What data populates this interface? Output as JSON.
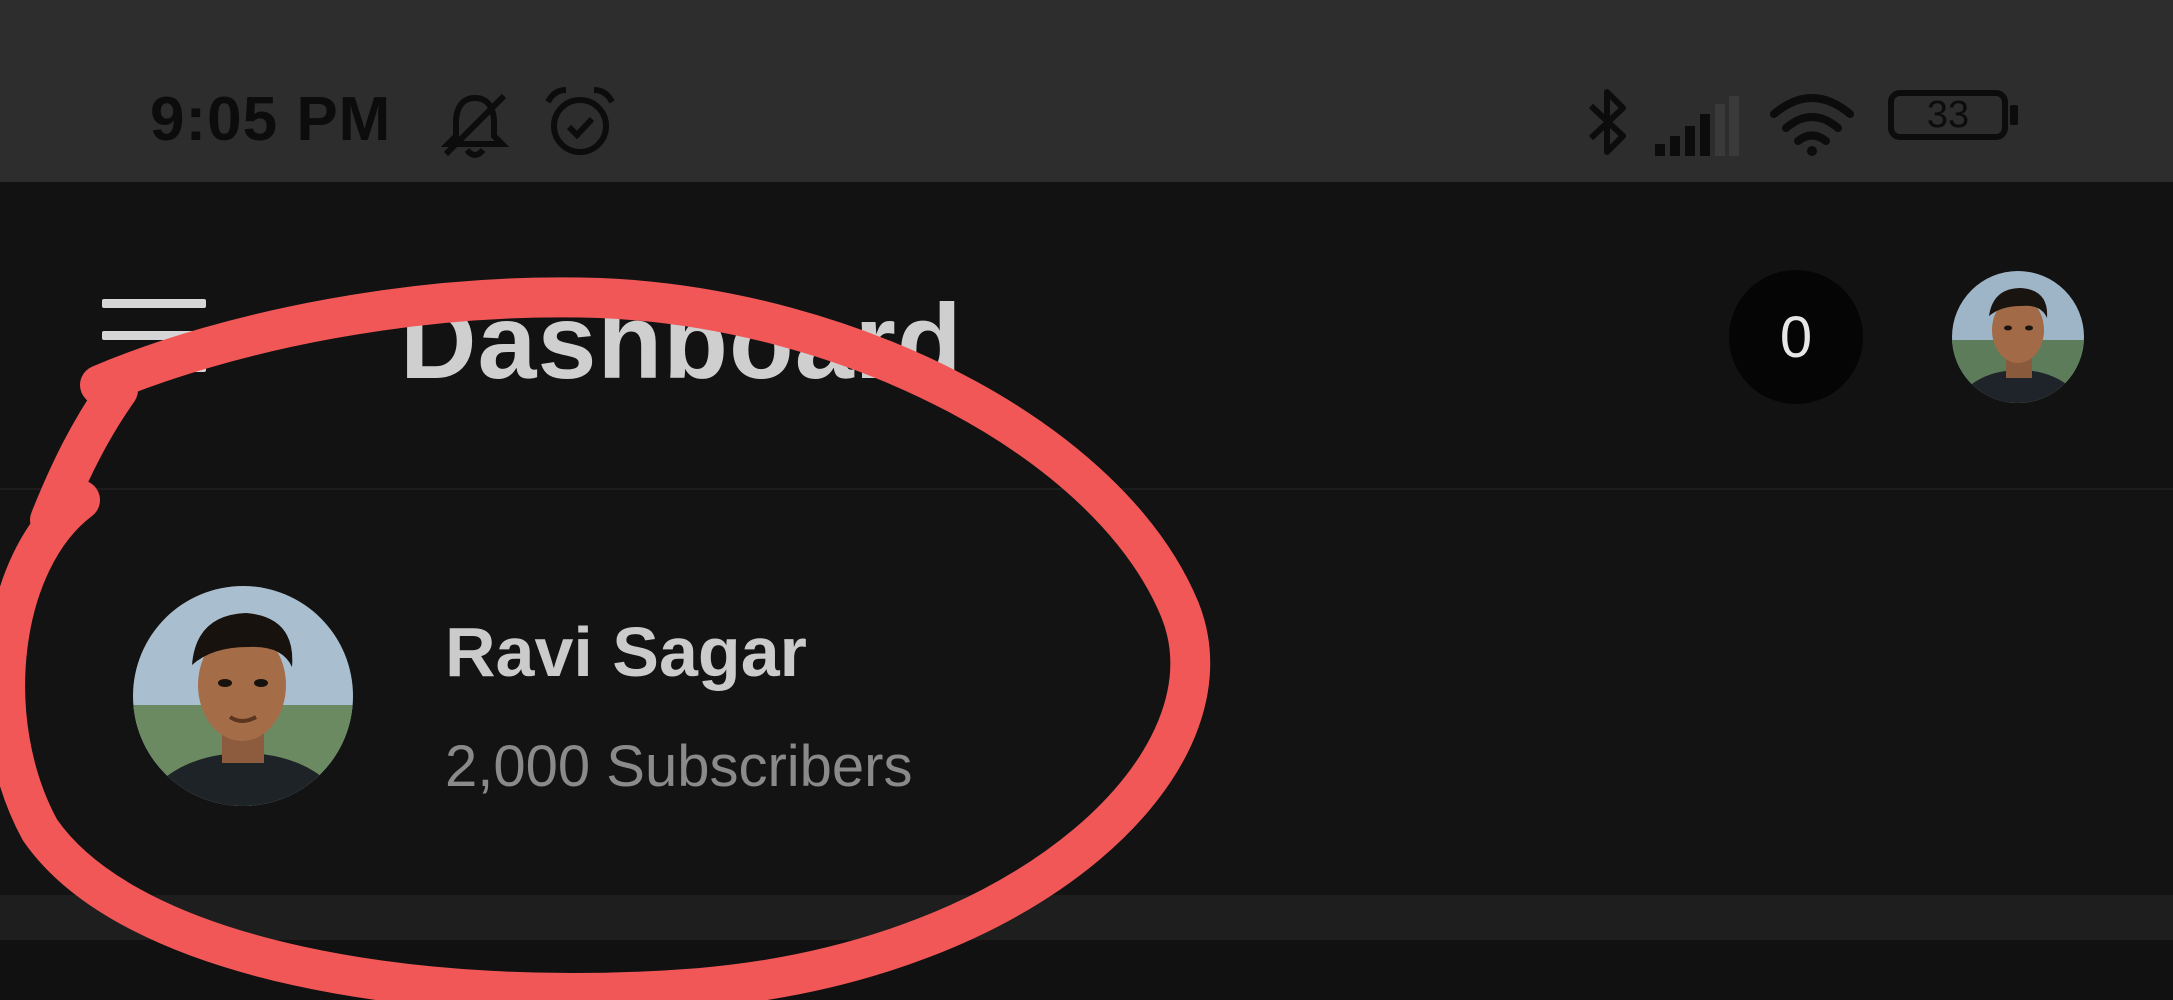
{
  "status_bar": {
    "time": "9:05 PM",
    "icons": [
      "dnd-bell-off-icon",
      "alarm-icon",
      "bluetooth-icon",
      "signal-icon",
      "wifi-icon",
      "battery-icon"
    ],
    "battery_level": "33"
  },
  "app_bar": {
    "title": "Dashboard",
    "notification_count": "0",
    "icons": [
      "hamburger-menu-icon",
      "profile-avatar-icon"
    ]
  },
  "channel": {
    "name": "Ravi Sagar",
    "subscribers": "2,000 Subscribers"
  },
  "colors": {
    "status_bar_bg": "#2d2d2d",
    "app_bg": "#121212",
    "annotation_stroke": "#f25757"
  }
}
